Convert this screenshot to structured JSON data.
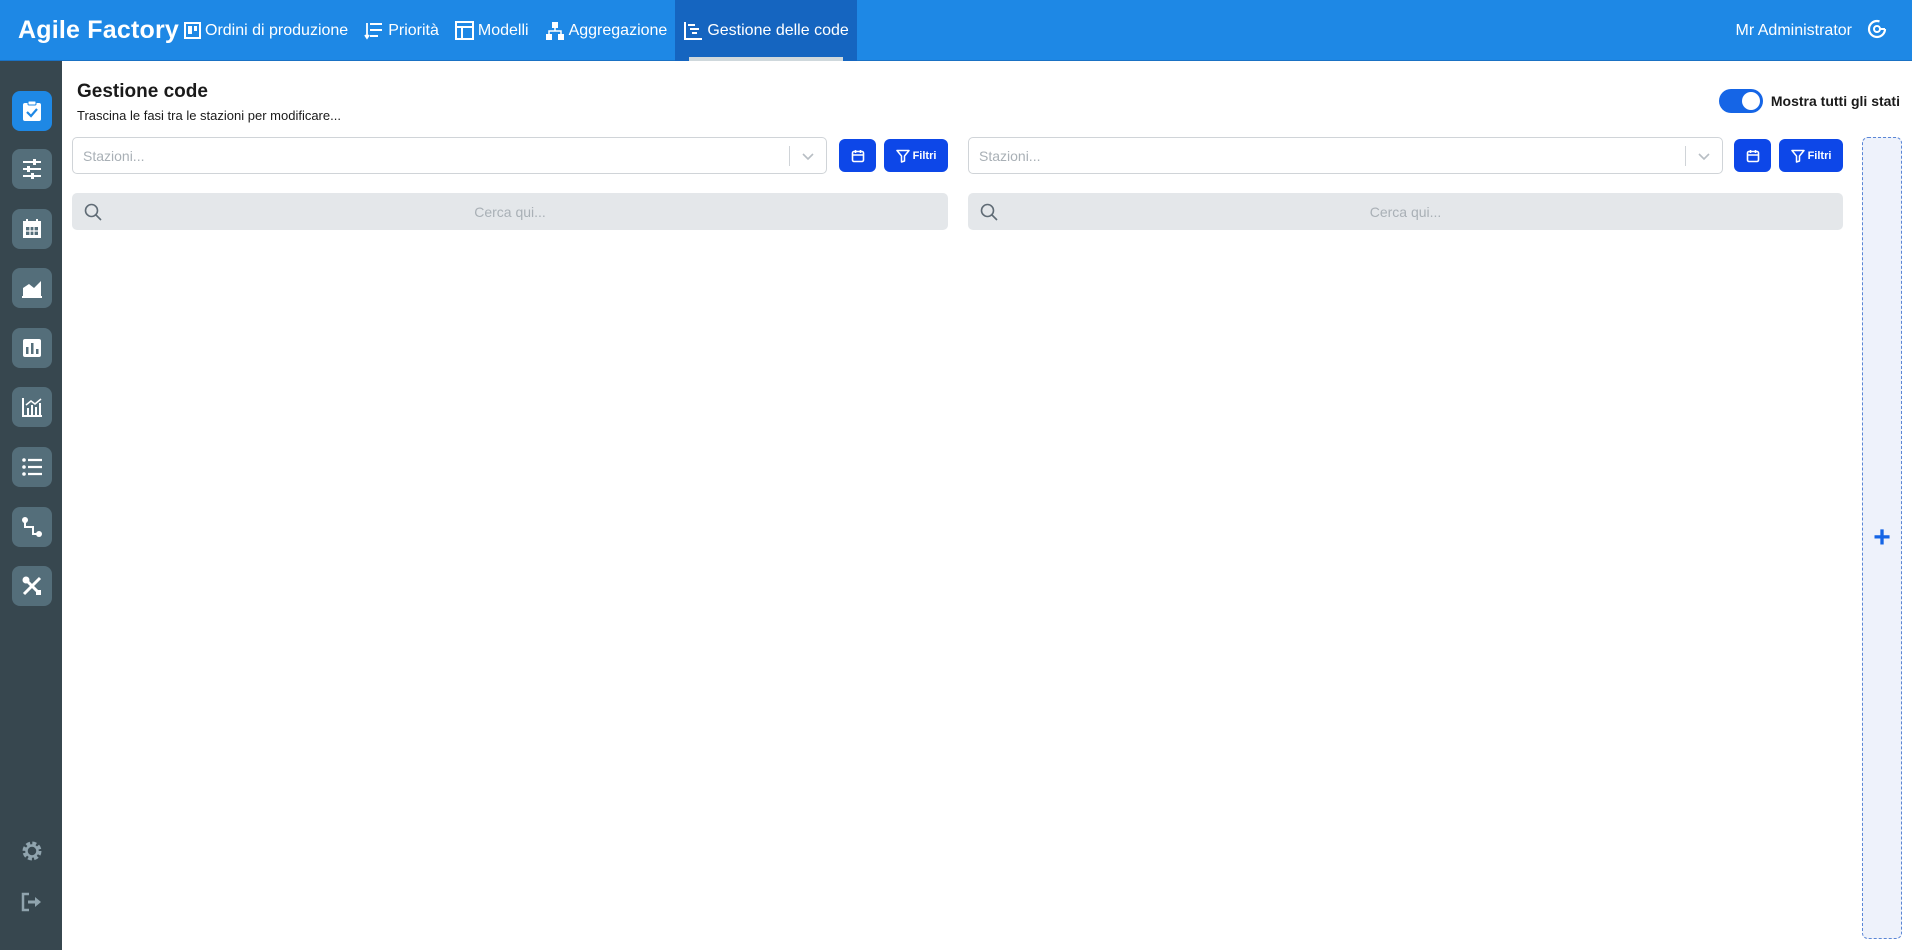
{
  "app": {
    "brand": "Agile Factory",
    "nav": [
      {
        "label": "Ordini di produzione",
        "icon": "board-icon"
      },
      {
        "label": "Priorità",
        "icon": "priority-icon"
      },
      {
        "label": "Modelli",
        "icon": "template-icon"
      },
      {
        "label": "Aggregazione",
        "icon": "aggregation-icon"
      },
      {
        "label": "Gestione delle code",
        "icon": "queue-icon",
        "active": true
      }
    ],
    "user": "Mr Administrator",
    "accent": "#1e88e5",
    "button_color": "#0d47e8"
  },
  "sidebar": {
    "items": [
      "tasks-icon",
      "sliders-icon",
      "calendar-grid-icon",
      "area-chart-icon",
      "bar-chart-icon",
      "line-bar-chart-icon",
      "list-icon",
      "route-icon",
      "tools-icon"
    ],
    "bottom": [
      "gear-icon",
      "logout-icon"
    ]
  },
  "page": {
    "title": "Gestione code",
    "subtitle": "Trascina le fasi tra le stazioni per modificare...",
    "toggle_label": "Mostra tutti gli stati",
    "toggle_on": true
  },
  "columns": [
    {
      "select_placeholder": "Stazioni...",
      "filter_label": "Filtri",
      "search_placeholder": "Cerca qui..."
    },
    {
      "select_placeholder": "Stazioni...",
      "filter_label": "Filtri",
      "search_placeholder": "Cerca qui..."
    }
  ],
  "add_column": {
    "symbol": "+"
  }
}
